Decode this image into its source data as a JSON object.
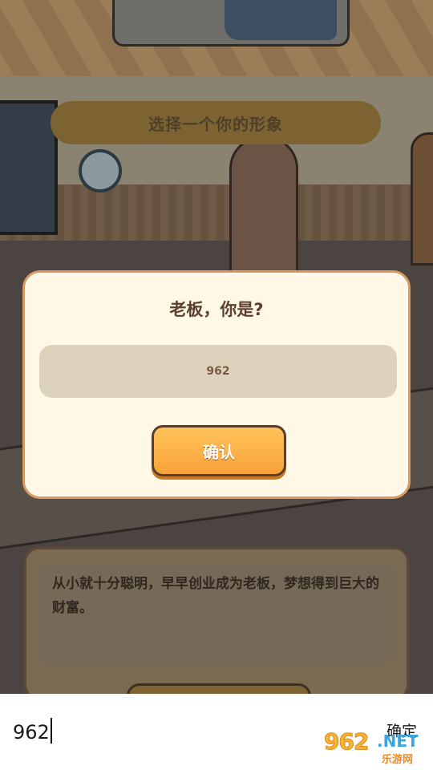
{
  "scene": {
    "select_title": "选择一个你的形象",
    "description": "从小就十分聪明，早早创业成为老板，梦想得到巨大的财富。"
  },
  "dialog": {
    "title": "老板，你是?",
    "name_value": "962",
    "confirm_label": "确认"
  },
  "ime": {
    "typed_text": "962",
    "confirm_label": "确定"
  },
  "watermark": {
    "main": "962",
    "net": ".NET",
    "sub": "乐游网"
  },
  "colors": {
    "button_orange": "#f9a33a",
    "modal_bg": "#fff8e6",
    "modal_border": "#d99a62",
    "field_bg": "#ddd3bd"
  }
}
